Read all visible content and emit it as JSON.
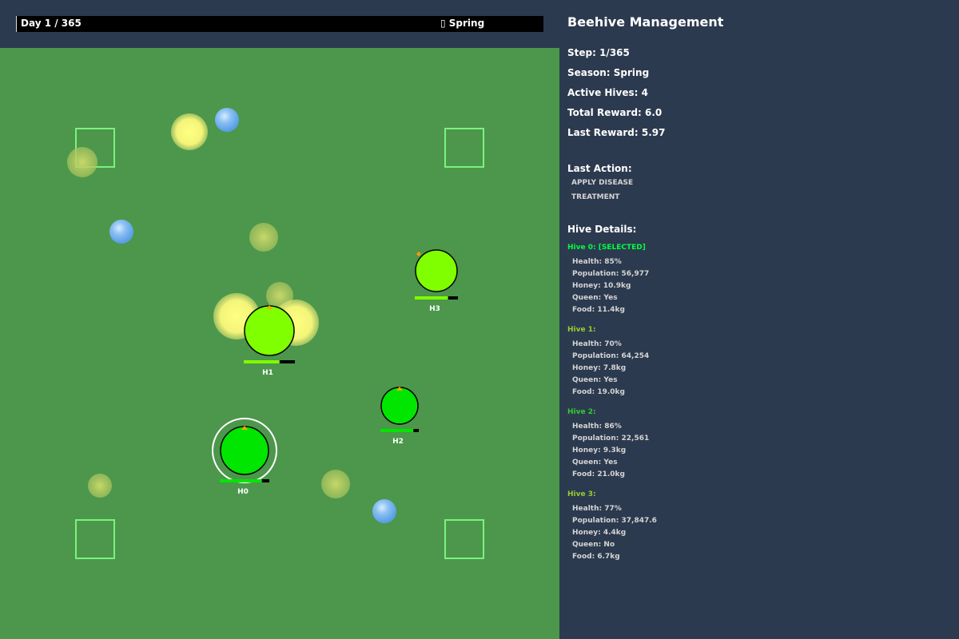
{
  "header": {
    "day_label": "Day 1 / 365",
    "season_icon": "season-glyph",
    "season_label": "▯ Spring"
  },
  "colors": {
    "field": "#4c974b",
    "panel": "#2c3a4f",
    "selected": "#00ff40",
    "hive_green": "#00e600",
    "hive_lime": "#7fff00"
  },
  "panel": {
    "title": "Beehive Management",
    "step": "Step: 1/365",
    "season": "Season: Spring",
    "active_hives": "Active Hives: 4",
    "total_reward": "Total Reward: 6.0",
    "last_reward": "Last Reward: 5.97",
    "last_action_label": "Last Action:",
    "last_action_line1": "APPLY DISEASE",
    "last_action_line2": "TREATMENT",
    "hive_details_label": "Hive Details:",
    "hives": [
      {
        "title": "Hive 0: [SELECTED]",
        "health": "Health: 85%",
        "population": "Population: 56,977",
        "honey": "Honey: 10.9kg",
        "queen": "Queen: Yes",
        "food": "Food: 11.4kg"
      },
      {
        "title": "Hive 1:",
        "health": "Health: 70%",
        "population": "Population: 64,254",
        "honey": "Honey: 7.8kg",
        "queen": "Queen: Yes",
        "food": "Food: 19.0kg"
      },
      {
        "title": "Hive 2:",
        "health": "Health: 86%",
        "population": "Population: 22,561",
        "honey": "Honey: 9.3kg",
        "queen": "Queen: Yes",
        "food": "Food: 21.0kg"
      },
      {
        "title": "Hive 3:",
        "health": "Health: 77%",
        "population": "Population: 37,847.6",
        "honey": "Honey: 4.4kg",
        "queen": "Queen: No",
        "food": "Food: 6.7kg"
      }
    ]
  },
  "map": {
    "hive_labels": [
      "H0",
      "H1",
      "H2",
      "H3"
    ],
    "hive_health": [
      0.85,
      0.7,
      0.86,
      0.77
    ],
    "selected_hive": 0
  }
}
